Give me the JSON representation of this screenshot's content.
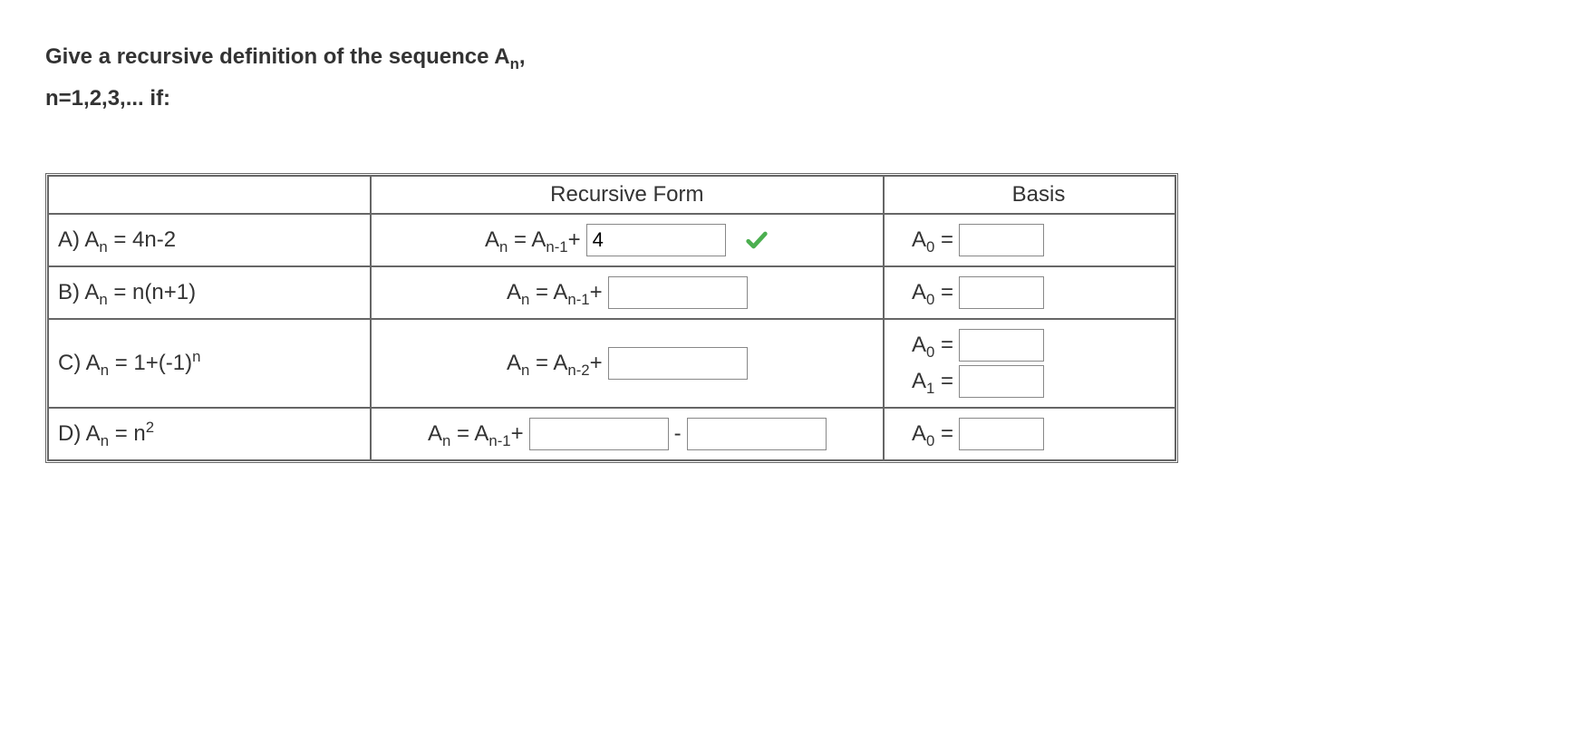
{
  "prompt": {
    "line1_pre": "Give a recursive definition of the sequence A",
    "line1_sub": "n",
    "line1_post": ",",
    "line2": "n=1,2,3,... if:"
  },
  "headers": {
    "recursive": "Recursive Form",
    "basis": "Basis"
  },
  "rows": {
    "a": {
      "label_pre": "A) A",
      "label_sub": "n",
      "label_post": " = 4n-2",
      "rec_pre": "A",
      "rec_sub1": "n",
      "rec_mid": " = A",
      "rec_sub2": "n-1",
      "rec_post": "+",
      "input_value": "4",
      "basis_label_pre": "A",
      "basis_label_sub": "0",
      "basis_label_post": " ="
    },
    "b": {
      "label_pre": "B) A",
      "label_sub": "n",
      "label_post": " = n(n+1)",
      "rec_pre": "A",
      "rec_sub1": "n",
      "rec_mid": " = A",
      "rec_sub2": "n-1",
      "rec_post": "+",
      "basis_label_pre": "A",
      "basis_label_sub": "0",
      "basis_label_post": " ="
    },
    "c": {
      "label_pre": "C) A",
      "label_sub": "n",
      "label_post": " = 1+(-1)",
      "label_sup": "n",
      "rec_pre": "A",
      "rec_sub1": "n",
      "rec_mid": " = A",
      "rec_sub2": "n-2",
      "rec_post": "+",
      "basis1_pre": "A",
      "basis1_sub": "0",
      "basis1_post": " =",
      "basis2_pre": "A",
      "basis2_sub": "1",
      "basis2_post": " ="
    },
    "d": {
      "label_pre": "D) A",
      "label_sub": "n",
      "label_post": " = n",
      "label_sup": "2",
      "rec_pre": "A",
      "rec_sub1": "n",
      "rec_mid": " = A",
      "rec_sub2": "n-1",
      "rec_post": "+",
      "rec_dash": "-",
      "basis_label_pre": "A",
      "basis_label_sub": "0",
      "basis_label_post": " ="
    }
  }
}
